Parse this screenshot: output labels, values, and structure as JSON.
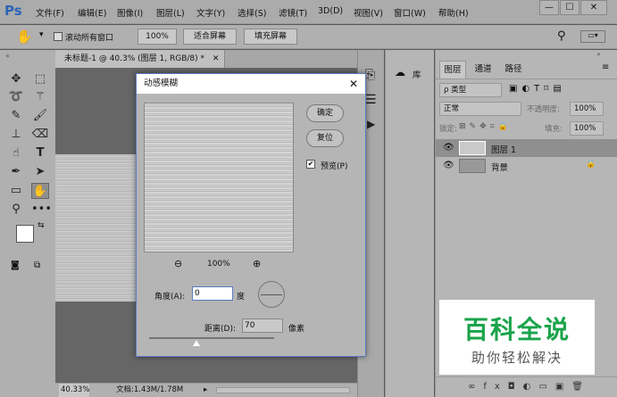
{
  "app": {
    "logo": "Ps"
  },
  "menu": [
    "文件(F)",
    "编辑(E)",
    "图像(I)",
    "图层(L)",
    "文字(Y)",
    "选择(S)",
    "滤镜(T)",
    "3D(D)",
    "视图(V)",
    "窗口(W)",
    "帮助(H)"
  ],
  "window_controls": {
    "minimize": "—",
    "maximize": "☐",
    "close": "✕"
  },
  "options_bar": {
    "scroll_all": "滚动所有窗口",
    "zoom": "100%",
    "fit_screen": "适合屏幕",
    "fill_screen": "填充屏幕"
  },
  "document_tab": {
    "title": "未标题-1 @ 40.3% (图层 1, RGB/8) *",
    "close": "✕"
  },
  "status_bar": {
    "zoom": "40.33%",
    "doc": "文档:1.43M/1.78M"
  },
  "library": {
    "label": "库"
  },
  "layers_panel": {
    "tabs": [
      "图层",
      "通道",
      "路径"
    ],
    "filter_kind": "ρ 类型",
    "blend_mode": "正常",
    "opacity_label": "不透明度:",
    "opacity": "100%",
    "lock_label": "锁定:",
    "fill_label": "填充:",
    "fill": "100%",
    "layers": [
      {
        "name": "图层 1",
        "selected": true
      },
      {
        "name": "背景",
        "selected": false
      }
    ]
  },
  "dialog": {
    "title": "动感模糊",
    "ok": "确定",
    "reset": "复位",
    "preview_label": "预览(P)",
    "preview_checked": true,
    "zoom": "100%",
    "angle_label": "角度(A):",
    "angle_value": "0",
    "angle_unit": "度",
    "distance_label": "距离(D):",
    "distance_value": "70",
    "distance_unit": "像素",
    "distance_level": 0.14
  },
  "watermark": {
    "line1": "百科全说",
    "line2": "助你轻松解决"
  },
  "colors": {
    "accent": "#2b64b7",
    "watermark_green": "#1aa34a"
  }
}
